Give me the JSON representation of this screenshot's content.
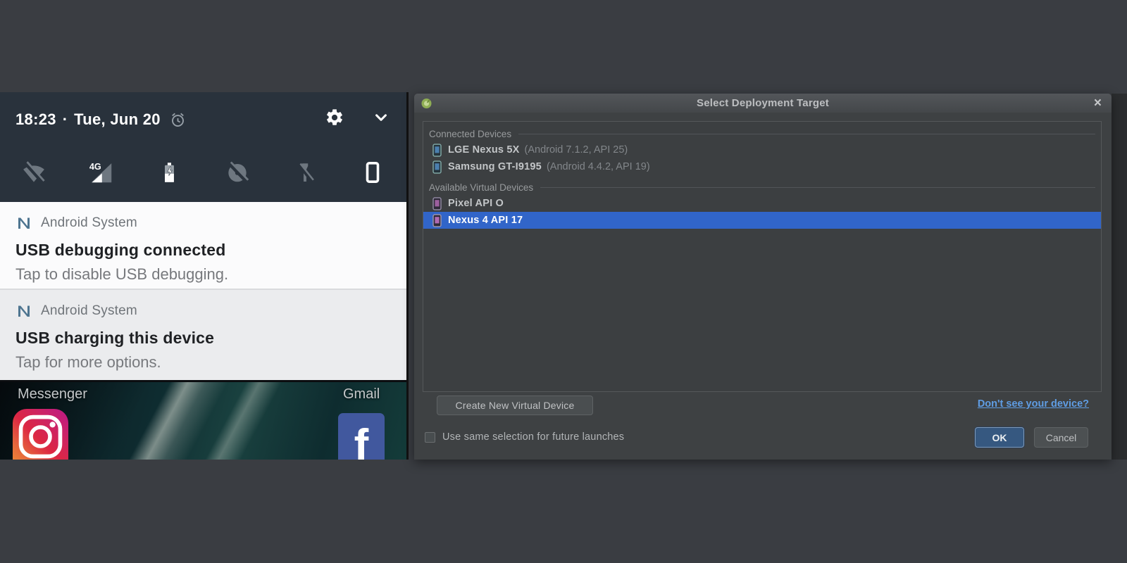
{
  "phone": {
    "status_bar": {
      "time": "18:23",
      "separator": "·",
      "date": "Tue, Jun 20",
      "icons": [
        "alarm-icon",
        "settings-gear-icon",
        "chevron-down-icon"
      ]
    },
    "quick_settings": {
      "signal_label": "4G",
      "icons": [
        "wifi-off",
        "signal-4g",
        "battery-charging",
        "location-off",
        "flashlight-off",
        "portrait-mode"
      ]
    },
    "notifications": [
      {
        "app": "Android System",
        "title": "USB debugging connected",
        "body": "Tap to disable USB debugging."
      },
      {
        "app": "Android System",
        "title": "USB charging this device",
        "body": "Tap for more options."
      }
    ],
    "home": {
      "app_labels": [
        "Messenger",
        "Gmail"
      ],
      "app_icons": [
        "instagram-icon",
        "facebook-icon"
      ]
    }
  },
  "dialog": {
    "title": "Select Deployment Target",
    "close_glyph": "×",
    "sections": [
      {
        "header": "Connected Devices",
        "devices": [
          {
            "name": "LGE Nexus 5X",
            "detail": "(Android 7.1.2, API 25)",
            "type": "physical",
            "selected": false
          },
          {
            "name": "Samsung GT-I9195",
            "detail": "(Android 4.4.2, API 19)",
            "type": "physical",
            "selected": false
          }
        ]
      },
      {
        "header": "Available Virtual Devices",
        "devices": [
          {
            "name": "Pixel API O",
            "detail": "",
            "type": "virtual",
            "selected": false
          },
          {
            "name": "Nexus 4 API 17",
            "detail": "",
            "type": "virtual",
            "selected": true
          }
        ]
      }
    ],
    "create_button": "Create New Virtual Device",
    "link": "Don't see your device?",
    "checkbox_label": "Use same selection for future launches",
    "checkbox_checked": false,
    "ok_label": "OK",
    "cancel_label": "Cancel"
  },
  "colors": {
    "pageBg": "#3a3d42",
    "statusBg": "#29323c",
    "dialogBg": "#3e4143",
    "titlebarBg": "#53565a",
    "panelBorder": "#55585a",
    "selection": "#3165c9",
    "link": "#5f9de4",
    "okBg": "#365880",
    "facebook": "#41589e",
    "nLogo": "#4e7590"
  }
}
